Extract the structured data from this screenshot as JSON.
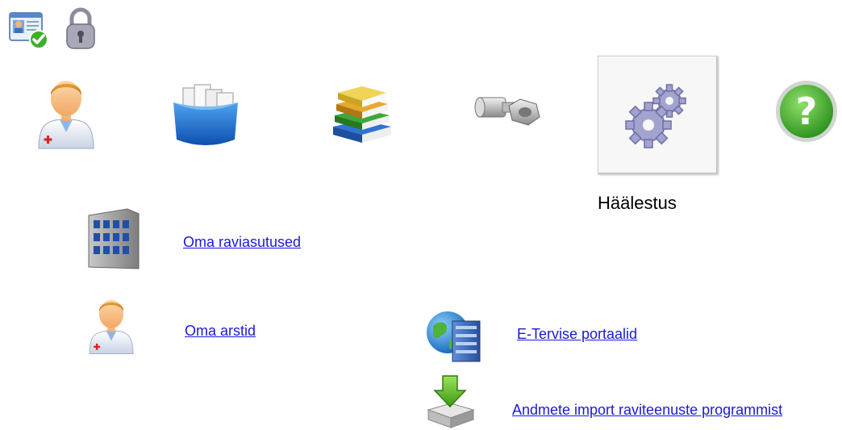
{
  "top_icons": [
    {
      "name": "id-card-check-icon"
    },
    {
      "name": "padlock-icon"
    }
  ],
  "nav": {
    "items": [
      {
        "icon": "doctor-icon"
      },
      {
        "icon": "folder-box-icon"
      },
      {
        "icon": "books-icon"
      },
      {
        "icon": "bolt-nut-icon"
      },
      {
        "icon": "gears-icon",
        "selected": true
      },
      {
        "icon": "help-icon"
      }
    ],
    "selected_label": "Häälestus"
  },
  "links": {
    "institutions": "Oma raviasutused",
    "doctors": "Oma arstid",
    "portals": "E-Tervise portaalid",
    "import": "Andmete import raviteenuste programmist"
  },
  "colors": {
    "link": "#1a1ad6",
    "help_green": "#3fae2a",
    "gear_purple": "#9a9ac8"
  }
}
